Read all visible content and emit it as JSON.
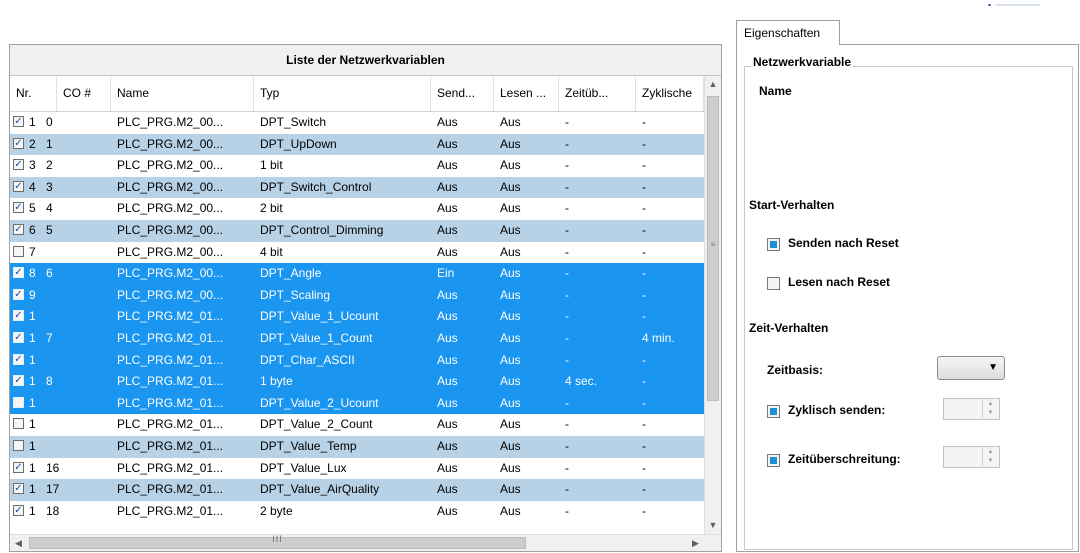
{
  "list": {
    "title": "Liste der Netzwerkvariablen",
    "columns": [
      "Nr.",
      "CO #",
      "Name",
      "Typ",
      "Send...",
      "Lesen ...",
      "Zeitüb...",
      "Zyklische"
    ],
    "rows": [
      {
        "checked": true,
        "nr": "1",
        "co": "0",
        "name": "PLC_PRG.M2_00...",
        "typ": "DPT_Switch",
        "send": "Aus",
        "lesen": "Aus",
        "zeit": "-",
        "zyk": "-"
      },
      {
        "checked": true,
        "nr": "2",
        "co": "1",
        "name": "PLC_PRG.M2_00...",
        "typ": "DPT_UpDown",
        "send": "Aus",
        "lesen": "Aus",
        "zeit": "-",
        "zyk": "-"
      },
      {
        "checked": true,
        "nr": "3",
        "co": "2",
        "name": "PLC_PRG.M2_00...",
        "typ": "1 bit",
        "send": "Aus",
        "lesen": "Aus",
        "zeit": "-",
        "zyk": "-"
      },
      {
        "checked": true,
        "nr": "4",
        "co": "3",
        "name": "PLC_PRG.M2_00...",
        "typ": "DPT_Switch_Control",
        "send": "Aus",
        "lesen": "Aus",
        "zeit": "-",
        "zyk": "-"
      },
      {
        "checked": true,
        "nr": "5",
        "co": "4",
        "name": "PLC_PRG.M2_00...",
        "typ": "2 bit",
        "send": "Aus",
        "lesen": "Aus",
        "zeit": "-",
        "zyk": "-"
      },
      {
        "checked": true,
        "nr": "6",
        "co": "5",
        "name": "PLC_PRG.M2_00...",
        "typ": "DPT_Control_Dimming",
        "send": "Aus",
        "lesen": "Aus",
        "zeit": "-",
        "zyk": "-"
      },
      {
        "checked": false,
        "nr": "7",
        "co": "",
        "name": "PLC_PRG.M2_00...",
        "typ": "4 bit",
        "send": "Aus",
        "lesen": "Aus",
        "zeit": "-",
        "zyk": "-"
      },
      {
        "checked": true,
        "nr": "8",
        "co": "6",
        "name": "PLC_PRG.M2_00...",
        "typ": "DPT_Angle",
        "send": "Ein",
        "lesen": "Aus",
        "zeit": "-",
        "zyk": "-"
      },
      {
        "checked": true,
        "nr": "9",
        "co": "",
        "name": "PLC_PRG.M2_00...",
        "typ": "DPT_Scaling",
        "send": "Aus",
        "lesen": "Aus",
        "zeit": "-",
        "zyk": "-"
      },
      {
        "checked": true,
        "nr": "1",
        "co": "",
        "name": "PLC_PRG.M2_01...",
        "typ": "DPT_Value_1_Ucount",
        "send": "Aus",
        "lesen": "Aus",
        "zeit": "-",
        "zyk": "-"
      },
      {
        "checked": true,
        "nr": "1",
        "co": "7",
        "name": "PLC_PRG.M2_01...",
        "typ": "DPT_Value_1_Count",
        "send": "Aus",
        "lesen": "Aus",
        "zeit": "-",
        "zyk": "4 min."
      },
      {
        "checked": true,
        "nr": "1",
        "co": "",
        "name": "PLC_PRG.M2_01...",
        "typ": "DPT_Char_ASCII",
        "send": "Aus",
        "lesen": "Aus",
        "zeit": "-",
        "zyk": "-"
      },
      {
        "checked": true,
        "nr": "1",
        "co": "8",
        "name": "PLC_PRG.M2_01...",
        "typ": "1 byte",
        "send": "Aus",
        "lesen": "Aus",
        "zeit": "4 sec.",
        "zyk": "-"
      },
      {
        "checked": false,
        "nr": "1",
        "co": "",
        "name": "PLC_PRG.M2_01...",
        "typ": "DPT_Value_2_Ucount",
        "send": "Aus",
        "lesen": "Aus",
        "zeit": "-",
        "zyk": "-"
      },
      {
        "checked": false,
        "nr": "1",
        "co": "",
        "name": "PLC_PRG.M2_01...",
        "typ": "DPT_Value_2_Count",
        "send": "Aus",
        "lesen": "Aus",
        "zeit": "-",
        "zyk": "-"
      },
      {
        "checked": false,
        "nr": "1",
        "co": "",
        "name": "PLC_PRG.M2_01...",
        "typ": "DPT_Value_Temp",
        "send": "Aus",
        "lesen": "Aus",
        "zeit": "-",
        "zyk": "-"
      },
      {
        "checked": true,
        "nr": "1",
        "co": "16",
        "name": "PLC_PRG.M2_01...",
        "typ": "DPT_Value_Lux",
        "send": "Aus",
        "lesen": "Aus",
        "zeit": "-",
        "zyk": "-"
      },
      {
        "checked": true,
        "nr": "1",
        "co": "17",
        "name": "PLC_PRG.M2_01...",
        "typ": "DPT_Value_AirQuality",
        "send": "Aus",
        "lesen": "Aus",
        "zeit": "-",
        "zyk": "-"
      },
      {
        "checked": true,
        "nr": "1",
        "co": "18",
        "name": "PLC_PRG.M2_01...",
        "typ": "2 byte",
        "send": "Aus",
        "lesen": "Aus",
        "zeit": "-",
        "zyk": "-"
      }
    ],
    "selected_rows": [
      7,
      8,
      9,
      10,
      11,
      12,
      13
    ],
    "scroll_grip": "≡",
    "hscroll_grip": "III"
  },
  "props": {
    "tab_label": "Eigenschaften",
    "group_title": "Netzwerkvariable",
    "name_label": "Name",
    "start_title": "Start-Verhalten",
    "senden_reset": "Senden nach Reset",
    "senden_reset_checked": true,
    "lesen_reset": "Lesen nach Reset",
    "lesen_reset_checked": false,
    "zeit_title": "Zeit-Verhalten",
    "zeitbasis_label": "Zeitbasis:",
    "zyklisch_label": "Zyklisch senden:",
    "zyklisch_checked": true,
    "zeitueber_label": "Zeitüberschreitung:",
    "zeitueber_checked": true
  },
  "colors": {
    "row_alt": "#b7d2e6",
    "row_selected": "#1a95f0",
    "checkbox_on": "#1e8fd6"
  }
}
